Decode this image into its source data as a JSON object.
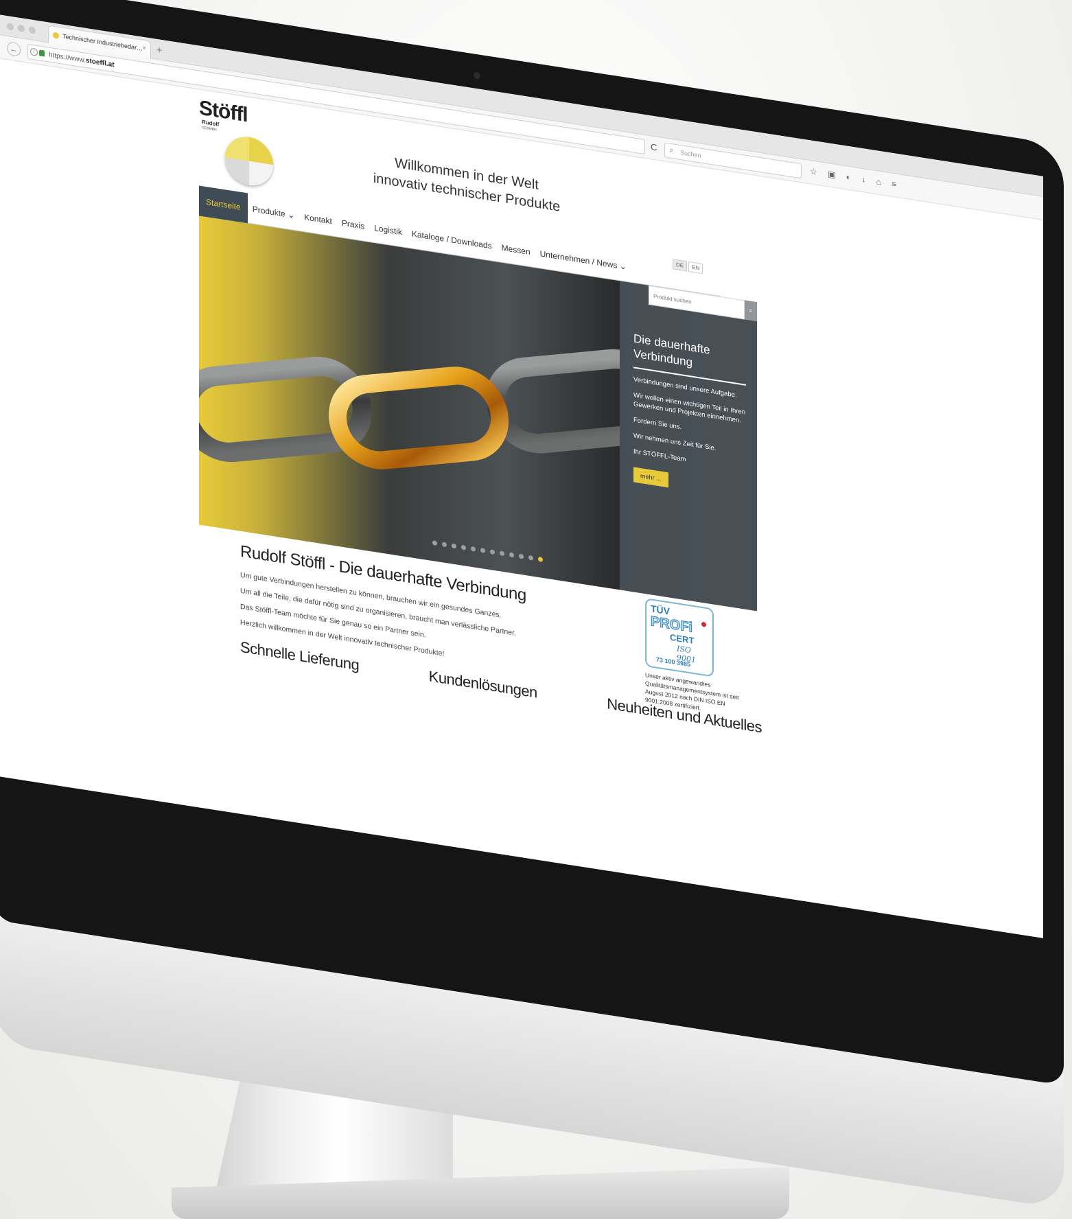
{
  "browser": {
    "tab_title": "Technischer Industriebedar…",
    "tab_close": "×",
    "new_tab": "+",
    "url_prefix": "https://www.",
    "url_host": "stoeffl.at",
    "reload": "C",
    "search_placeholder": "Suchen",
    "toolbar_icons": "☆ ▣ ◐ ↓ ⌂ ≡"
  },
  "site": {
    "logo": {
      "name": "Stöffl",
      "sub": "Rudolf",
      "sub2": "GESMBH"
    },
    "welcome_line1": "Willkommen in der Welt",
    "welcome_line2": "innovativ technischer Produkte",
    "languages": [
      "DE",
      "EN"
    ],
    "nav": [
      {
        "label": "Startseite",
        "active": true
      },
      {
        "label": "Produkte ⌄"
      },
      {
        "label": "Kontakt"
      },
      {
        "label": "Praxis"
      },
      {
        "label": "Logistik"
      },
      {
        "label": "Kataloge / Downloads"
      },
      {
        "label": "Messen"
      },
      {
        "label": "Unternehmen / News ⌄"
      }
    ],
    "product_search_placeholder": "Produkt suchen",
    "hero": {
      "title": "Die dauerhafte Verbindung",
      "lines": [
        "Verbindungen sind unsere Aufgabe.",
        "Wir wollen einen wichtigen Teil in Ihren Gewerken und Projekten einnehmen.",
        "Fordern Sie uns.",
        "Wir nehmen uns Zeit für Sie.",
        "Ihr STÖFFL-Team"
      ],
      "more_label": "mehr ...",
      "slide_count": 12,
      "active_slide": 12
    },
    "intro": {
      "heading": "Rudolf Stöffl - Die dauerhafte Verbindung",
      "paragraphs": [
        "Um gute Verbindungen herstellen zu können, brauchen wir ein gesundes Ganzes.",
        "Um all die Teile, die dafür nötig sind zu organisieren, braucht man verlässliche Partner.",
        "Das Stöffl-Team möchte für Sie genau so ein Partner sein.",
        "Herzlich willkommen in der Welt innovativ technischer Produkte!"
      ]
    },
    "certificate": {
      "badge_tuv": "TÜV",
      "badge_profi": "PROFi",
      "badge_cert": "CERT",
      "badge_iso": "ISO 9001",
      "badge_number": "73 100 3985",
      "text": "Unser aktiv angewandtes Qualitätsmanagementsystem ist seit August 2012 nach DIN ISO EN 9001:2008 zertifiziert."
    },
    "features": [
      "Schnelle Lieferung",
      "Kundenlösungen",
      "Neuheiten und Aktuelles"
    ]
  },
  "colors": {
    "accent": "#e8c93a",
    "nav_active_bg": "#3f4b55",
    "panel": "#485056"
  }
}
